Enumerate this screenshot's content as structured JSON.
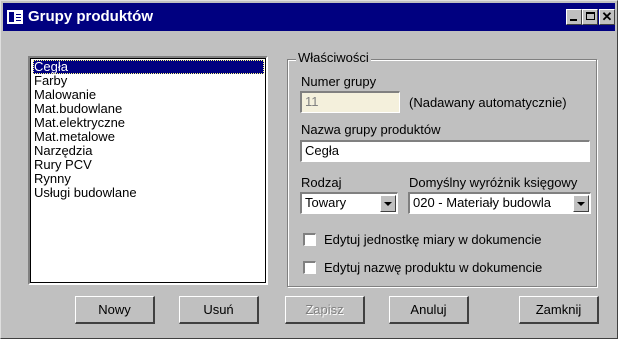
{
  "window": {
    "title": "Grupy produktów"
  },
  "list": {
    "items": [
      "Cegła",
      "Farby",
      "Malowanie",
      "Mat.budowlane",
      "Mat.elektryczne",
      "Mat.metalowe",
      "Narzędzia",
      "Rury PCV",
      "Rynny",
      "Usługi budowlane"
    ],
    "selected_index": 0
  },
  "properties": {
    "legend": "Właściwości",
    "group_number_label": "Numer grupy",
    "group_number_value": "11",
    "group_number_note": "(Nadawany automatycznie)",
    "group_name_label": "Nazwa grupy produktów",
    "group_name_value": "Cegła",
    "type_label": "Rodzaj",
    "type_value": "Towary",
    "accounting_label": "Domyślny wyróżnik księgowy",
    "accounting_value": "020 - Materiały budowla",
    "checkbox_unit_label": "Edytuj jednostkę miary w dokumencie",
    "checkbox_unit_checked": false,
    "checkbox_name_label": "Edytuj nazwę produktu w dokumencie",
    "checkbox_name_checked": false
  },
  "buttons": {
    "new_label": "Nowy",
    "delete_label": "Usuń",
    "save_label": "Zapisz",
    "cancel_label": "Anuluj",
    "close_label": "Zamknij"
  },
  "icons": {
    "window_icon": "window-list-icon",
    "minimize": "minimize-icon",
    "maximize": "maximize-icon",
    "close": "close-icon",
    "dropdown": "chevron-down-icon"
  },
  "colors": {
    "titlebar": "#000080",
    "face": "#c0c0c0",
    "disabled_field": "#f4f0dc",
    "selection": "#000080"
  }
}
